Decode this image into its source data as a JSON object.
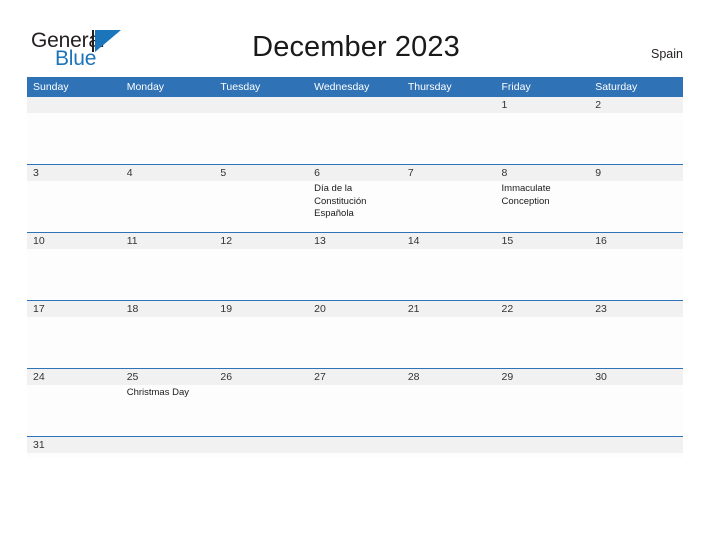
{
  "brand": {
    "name_part1": "General",
    "name_part2": "Blue",
    "mark_icon": "triangle-flag-icon"
  },
  "header": {
    "title": "December 2023",
    "locale": "Spain"
  },
  "calendar": {
    "weekdays": [
      "Sunday",
      "Monday",
      "Tuesday",
      "Wednesday",
      "Thursday",
      "Friday",
      "Saturday"
    ],
    "colors": {
      "header_blue": "#2f72b5",
      "rule_blue": "#2f72b5",
      "date_band_gray": "#f1f1f1",
      "brand_blue": "#1b75bb",
      "text_dark": "#1a1a1a"
    },
    "weeks": [
      {
        "days": [
          {
            "number": "",
            "events": []
          },
          {
            "number": "",
            "events": []
          },
          {
            "number": "",
            "events": []
          },
          {
            "number": "",
            "events": []
          },
          {
            "number": "",
            "events": []
          },
          {
            "number": "1",
            "events": []
          },
          {
            "number": "2",
            "events": []
          }
        ]
      },
      {
        "days": [
          {
            "number": "3",
            "events": []
          },
          {
            "number": "4",
            "events": []
          },
          {
            "number": "5",
            "events": []
          },
          {
            "number": "6",
            "events": [
              "Día de la Constitución Española"
            ]
          },
          {
            "number": "7",
            "events": []
          },
          {
            "number": "8",
            "events": [
              "Immaculate Conception"
            ]
          },
          {
            "number": "9",
            "events": []
          }
        ]
      },
      {
        "days": [
          {
            "number": "10",
            "events": []
          },
          {
            "number": "11",
            "events": []
          },
          {
            "number": "12",
            "events": []
          },
          {
            "number": "13",
            "events": []
          },
          {
            "number": "14",
            "events": []
          },
          {
            "number": "15",
            "events": []
          },
          {
            "number": "16",
            "events": []
          }
        ]
      },
      {
        "days": [
          {
            "number": "17",
            "events": []
          },
          {
            "number": "18",
            "events": []
          },
          {
            "number": "19",
            "events": []
          },
          {
            "number": "20",
            "events": []
          },
          {
            "number": "21",
            "events": []
          },
          {
            "number": "22",
            "events": []
          },
          {
            "number": "23",
            "events": []
          }
        ]
      },
      {
        "days": [
          {
            "number": "24",
            "events": []
          },
          {
            "number": "25",
            "events": [
              "Christmas Day"
            ]
          },
          {
            "number": "26",
            "events": []
          },
          {
            "number": "27",
            "events": []
          },
          {
            "number": "28",
            "events": []
          },
          {
            "number": "29",
            "events": []
          },
          {
            "number": "30",
            "events": []
          }
        ]
      },
      {
        "days": [
          {
            "number": "31",
            "events": []
          },
          {
            "number": "",
            "events": []
          },
          {
            "number": "",
            "events": []
          },
          {
            "number": "",
            "events": []
          },
          {
            "number": "",
            "events": []
          },
          {
            "number": "",
            "events": []
          },
          {
            "number": "",
            "events": []
          }
        ]
      }
    ]
  }
}
